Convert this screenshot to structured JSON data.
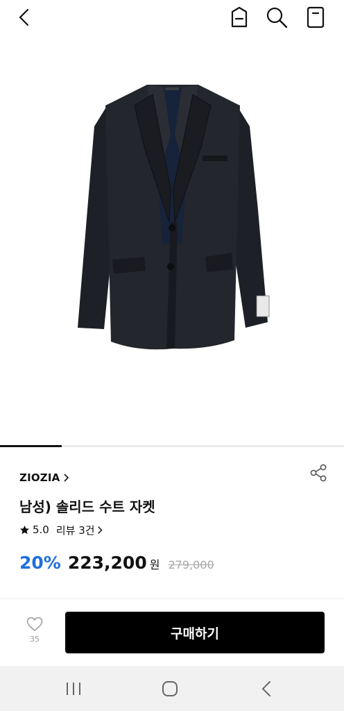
{
  "header": {
    "back_icon": "chevron-left-icon",
    "category_icon": "category-tag-icon",
    "search_icon": "search-icon",
    "bag_icon": "shopping-bag-icon"
  },
  "product": {
    "image": "navy-suit-jacket-photo",
    "image_progress": 0.18,
    "brand": "ZIOZIA",
    "title": "남성) 솔리드 수트 자켓",
    "rating": "5.0",
    "review_label": "리뷰 3건",
    "discount": "20%",
    "price": "223,200",
    "currency": "원",
    "original_price": "279,000"
  },
  "bottom_bar": {
    "like_count": "35",
    "buy_label": "구매하기"
  },
  "colors": {
    "discount": "#1f6fde",
    "buy_button": "#000000",
    "navbar": "#f1f1f1"
  }
}
